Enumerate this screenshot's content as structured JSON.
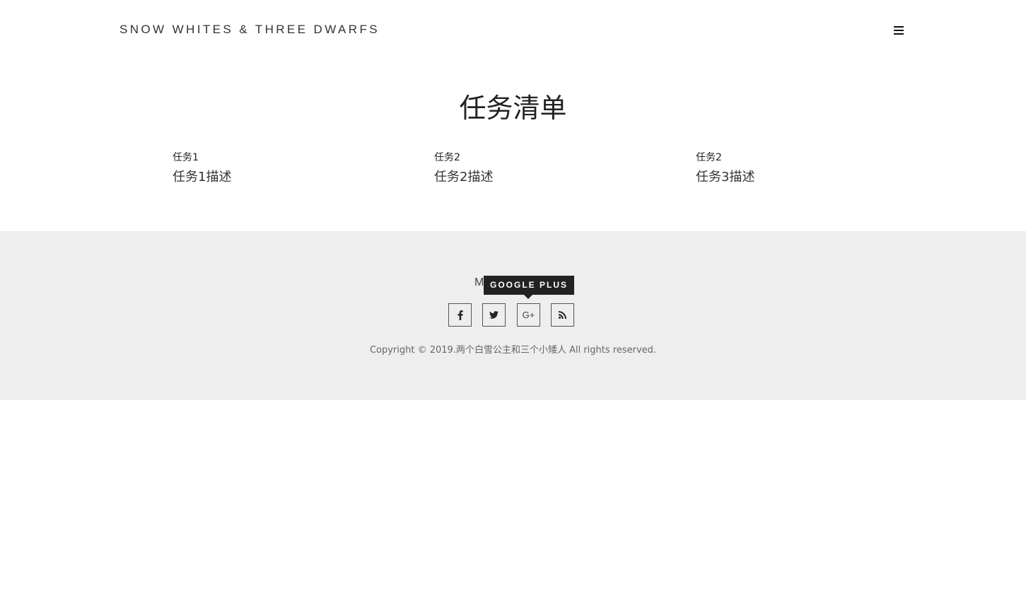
{
  "header": {
    "brand": "SNOW WHITES & THREE DWARFS",
    "menu_icon": "hamburger-menu-icon"
  },
  "main": {
    "title": "任务清单",
    "tasks": [
      {
        "name": "任务1",
        "description": "任务1描述"
      },
      {
        "name": "任务2",
        "description": "任务2描述"
      },
      {
        "name": "任务2",
        "description": "任务3描述"
      }
    ]
  },
  "footer": {
    "partial_text": "M",
    "tooltip": "GOOGLE PLUS",
    "social": [
      {
        "icon": "facebook-icon",
        "label": "f"
      },
      {
        "icon": "twitter-icon",
        "label": ""
      },
      {
        "icon": "google-plus-icon",
        "label": "G+"
      },
      {
        "icon": "rss-icon",
        "label": ""
      }
    ],
    "copyright": "Copyright © 2019.两个白雪公主和三个小矮人 All rights reserved.",
    "background": "#eeeeee"
  }
}
